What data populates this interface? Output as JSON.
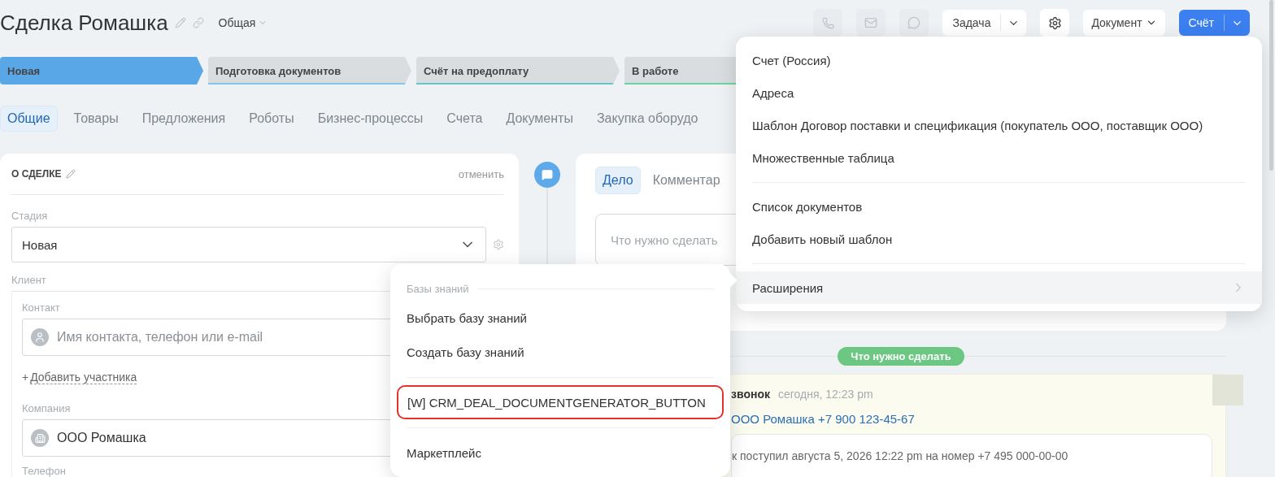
{
  "header": {
    "title": "Сделка Ромашка",
    "category": "Общая"
  },
  "toolbar": {
    "task_button": "Задача",
    "document_button": "Документ",
    "invoice_button": "Счёт"
  },
  "stages": [
    {
      "label": "Новая",
      "selected": true,
      "color": "#5aa7e8"
    },
    {
      "label": "Подготовка документов",
      "selected": false,
      "color": "#7fc8e8"
    },
    {
      "label": "Счёт на предоплату",
      "selected": false,
      "color": "#69c6c8"
    },
    {
      "label": "В работе",
      "selected": false,
      "color": "#6fd3a0"
    }
  ],
  "tabs": [
    {
      "label": "Общие",
      "selected": true
    },
    {
      "label": "Товары",
      "selected": false
    },
    {
      "label": "Предложения",
      "selected": false
    },
    {
      "label": "Роботы",
      "selected": false
    },
    {
      "label": "Бизнес-процессы",
      "selected": false
    },
    {
      "label": "Счета",
      "selected": false
    },
    {
      "label": "Документы",
      "selected": false
    },
    {
      "label": "Закупка оборудо",
      "selected": false
    }
  ],
  "deal_card": {
    "title": "О СДЕЛКЕ",
    "cancel": "отменить",
    "stage_label": "Стадия",
    "stage_value": "Новая",
    "client_label": "Клиент",
    "contact_label": "Контакт",
    "contact_placeholder": "Имя контакта, телефон или e-mail",
    "add_sign": "+",
    "add_participant": "Добавить участника",
    "company_label": "Компания",
    "company_value": "ООО Ромашка",
    "phone_label": "Телефон"
  },
  "activity": {
    "tabs": [
      {
        "label": "Дело",
        "selected": true
      },
      {
        "label": "Комментар",
        "selected": false
      }
    ],
    "placeholder": "Что нужно сделать"
  },
  "badge": "Что нужно сделать",
  "call_card": {
    "title": "звонок",
    "time": "сегодня, 12:23 pm",
    "link": "ООО Ромашка +7 900 123-45-67",
    "note": "к поступил августа 5, 2026 12:22 pm на номер +7 495 000-00-00"
  },
  "invoice_menu": {
    "groups": [
      [
        {
          "label": "Счет (Россия)",
          "kind": "item",
          "selected": false
        },
        {
          "label": "Адреса",
          "kind": "item",
          "selected": false
        },
        {
          "label": "Шаблон Договор поставки и спецификация (покупатель ООО, поставщик ООО)",
          "kind": "item",
          "selected": false
        },
        {
          "label": "Множественные таблица",
          "kind": "item",
          "selected": false
        }
      ],
      [
        {
          "label": "Список документов",
          "kind": "item",
          "selected": false
        },
        {
          "label": "Добавить новый шаблон",
          "kind": "item",
          "selected": false
        }
      ],
      [
        {
          "label": "Расширения",
          "kind": "submenu",
          "selected": true
        }
      ]
    ]
  },
  "submenu": {
    "header": "Базы знаний",
    "groups": [
      [
        {
          "label": "Выбрать базу знаний",
          "selected": false
        },
        {
          "label": "Создать базу знаний",
          "selected": false
        }
      ],
      [
        {
          "label": "[W] CRM_DEAL_DOCUMENTGENERATOR_BUTTON",
          "selected": true
        }
      ],
      [
        {
          "label": "Маркетплейс",
          "selected": false
        }
      ]
    ]
  }
}
